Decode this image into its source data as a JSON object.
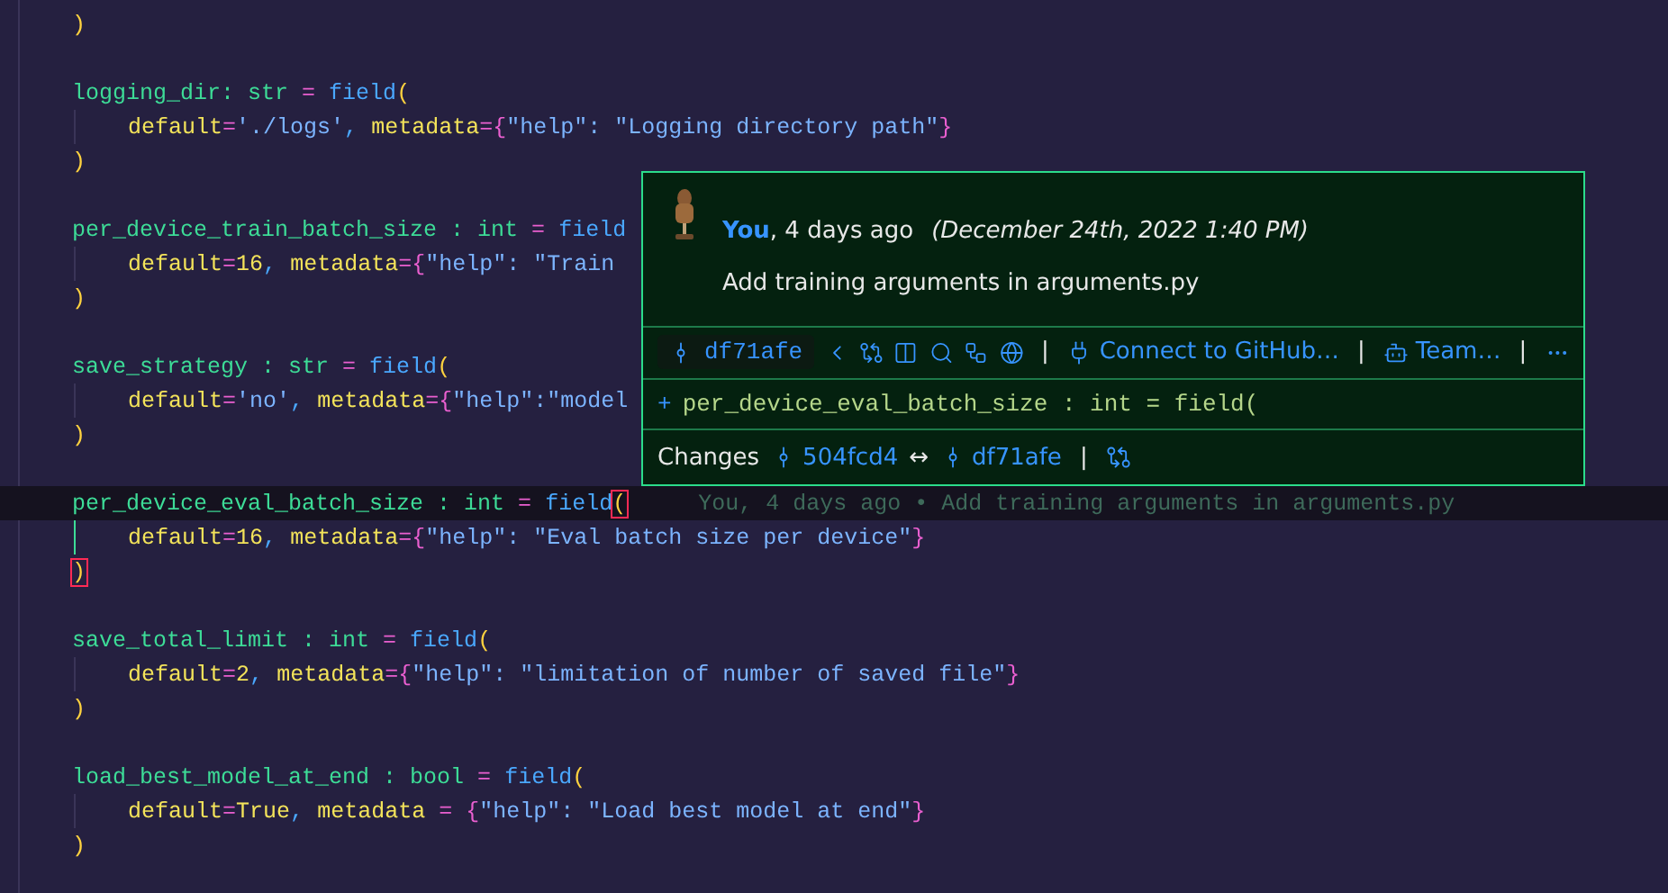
{
  "editor": {
    "lines": [
      {
        "kind": "code",
        "current": false,
        "tokens": [
          {
            "kind": "paren",
            "t": ")"
          }
        ]
      },
      {
        "kind": "blank",
        "current": false
      },
      {
        "kind": "code",
        "current": false,
        "tokens": [
          {
            "kind": "name",
            "t": "logging_dir: str "
          },
          {
            "kind": "op",
            "t": "= "
          },
          {
            "kind": "func",
            "t": "field"
          },
          {
            "kind": "paren",
            "t": "("
          }
        ]
      },
      {
        "kind": "inner",
        "current": false,
        "tokens": [
          {
            "kind": "param",
            "t": "default"
          },
          {
            "kind": "op",
            "t": "="
          },
          {
            "kind": "str",
            "t": "'./logs'"
          },
          {
            "kind": "func",
            "t": ", "
          },
          {
            "kind": "param",
            "t": "metadata"
          },
          {
            "kind": "op",
            "t": "="
          },
          {
            "kind": "brace",
            "t": "{"
          },
          {
            "kind": "str",
            "t": "\"help\": \"Logging directory path\""
          },
          {
            "kind": "brace",
            "t": "}"
          }
        ]
      },
      {
        "kind": "code",
        "current": false,
        "tokens": [
          {
            "kind": "paren",
            "t": ")"
          }
        ]
      },
      {
        "kind": "blank",
        "current": false
      },
      {
        "kind": "code",
        "current": false,
        "tokens": [
          {
            "kind": "name",
            "t": "per_device_train_batch_size : int "
          },
          {
            "kind": "op",
            "t": "= "
          },
          {
            "kind": "func",
            "t": "field"
          }
        ]
      },
      {
        "kind": "inner",
        "current": false,
        "tokens": [
          {
            "kind": "param",
            "t": "default"
          },
          {
            "kind": "op",
            "t": "="
          },
          {
            "kind": "param",
            "t": "16"
          },
          {
            "kind": "func",
            "t": ", "
          },
          {
            "kind": "param",
            "t": "metadata"
          },
          {
            "kind": "op",
            "t": "="
          },
          {
            "kind": "brace",
            "t": "{"
          },
          {
            "kind": "str",
            "t": "\"help\": \"Train"
          }
        ]
      },
      {
        "kind": "code",
        "current": false,
        "tokens": [
          {
            "kind": "paren",
            "t": ")"
          }
        ]
      },
      {
        "kind": "blank",
        "current": false
      },
      {
        "kind": "code",
        "current": false,
        "tokens": [
          {
            "kind": "name",
            "t": "save_strategy : str "
          },
          {
            "kind": "op",
            "t": "= "
          },
          {
            "kind": "func",
            "t": "field"
          },
          {
            "kind": "paren",
            "t": "("
          }
        ]
      },
      {
        "kind": "inner",
        "current": false,
        "tokens": [
          {
            "kind": "param",
            "t": "default"
          },
          {
            "kind": "op",
            "t": "="
          },
          {
            "kind": "str",
            "t": "'no'"
          },
          {
            "kind": "func",
            "t": ", "
          },
          {
            "kind": "param",
            "t": "metadata"
          },
          {
            "kind": "op",
            "t": "="
          },
          {
            "kind": "brace",
            "t": "{"
          },
          {
            "kind": "str",
            "t": "\"help\":\"model"
          }
        ]
      },
      {
        "kind": "code",
        "current": false,
        "tokens": [
          {
            "kind": "paren",
            "t": ")"
          }
        ]
      },
      {
        "kind": "blank",
        "current": false
      },
      {
        "kind": "code",
        "current": true,
        "blame": "You, 4 days ago • Add training arguments in arguments.py",
        "tokens": [
          {
            "kind": "name",
            "t": "per_device_eval_batch_size : int "
          },
          {
            "kind": "op",
            "t": "= "
          },
          {
            "kind": "func",
            "t": "field"
          },
          {
            "kind": "match",
            "t": "("
          }
        ]
      },
      {
        "kind": "inner",
        "current": false,
        "tokens": [
          {
            "kind": "param",
            "t": "default"
          },
          {
            "kind": "op",
            "t": "="
          },
          {
            "kind": "param",
            "t": "16"
          },
          {
            "kind": "func",
            "t": ", "
          },
          {
            "kind": "param",
            "t": "metadata"
          },
          {
            "kind": "op",
            "t": "="
          },
          {
            "kind": "brace",
            "t": "{"
          },
          {
            "kind": "str",
            "t": "\"help\": \"Eval batch size per device\""
          },
          {
            "kind": "brace",
            "t": "}"
          }
        ]
      },
      {
        "kind": "code",
        "current": false,
        "tokens": [
          {
            "kind": "match",
            "t": ")"
          }
        ]
      },
      {
        "kind": "blank",
        "current": false
      },
      {
        "kind": "code",
        "current": false,
        "tokens": [
          {
            "kind": "name",
            "t": "save_total_limit : int "
          },
          {
            "kind": "op",
            "t": "= "
          },
          {
            "kind": "func",
            "t": "field"
          },
          {
            "kind": "paren",
            "t": "("
          }
        ]
      },
      {
        "kind": "inner",
        "current": false,
        "tokens": [
          {
            "kind": "param",
            "t": "default"
          },
          {
            "kind": "op",
            "t": "="
          },
          {
            "kind": "param",
            "t": "2"
          },
          {
            "kind": "func",
            "t": ", "
          },
          {
            "kind": "param",
            "t": "metadata"
          },
          {
            "kind": "op",
            "t": "="
          },
          {
            "kind": "brace",
            "t": "{"
          },
          {
            "kind": "str",
            "t": "\"help\": \"limitation of number of saved file\""
          },
          {
            "kind": "brace",
            "t": "}"
          }
        ]
      },
      {
        "kind": "code",
        "current": false,
        "tokens": [
          {
            "kind": "paren",
            "t": ")"
          }
        ]
      },
      {
        "kind": "blank",
        "current": false
      },
      {
        "kind": "code",
        "current": false,
        "tokens": [
          {
            "kind": "name",
            "t": "load_best_model_at_end : bool "
          },
          {
            "kind": "op",
            "t": "= "
          },
          {
            "kind": "func",
            "t": "field"
          },
          {
            "kind": "paren",
            "t": "("
          }
        ]
      },
      {
        "kind": "inner",
        "current": false,
        "tokens": [
          {
            "kind": "param",
            "t": "default"
          },
          {
            "kind": "op",
            "t": "="
          },
          {
            "kind": "param",
            "t": "True"
          },
          {
            "kind": "func",
            "t": ", "
          },
          {
            "kind": "param",
            "t": "metadata "
          },
          {
            "kind": "op",
            "t": "= "
          },
          {
            "kind": "brace",
            "t": "{"
          },
          {
            "kind": "str",
            "t": "\"help\": \"Load best model at end\""
          },
          {
            "kind": "brace",
            "t": "}"
          }
        ]
      },
      {
        "kind": "code",
        "current": false,
        "tokens": [
          {
            "kind": "paren",
            "t": ")"
          }
        ]
      }
    ]
  },
  "hover": {
    "author": "You",
    "ago": ", 4 days ago",
    "date": "(December 24th, 2022 1:40 PM)",
    "message": "Add training arguments in arguments.py",
    "commit": "df71afe",
    "connect": "Connect to GitHub…",
    "team": "Team…",
    "separator": "|",
    "diff": {
      "sign": "+",
      "code": "per_device_eval_batch_size : int = field("
    },
    "changes": {
      "label": "Changes",
      "from": "504fcd4",
      "arrow": "↔",
      "to": "df71afe",
      "separator": "|"
    }
  }
}
